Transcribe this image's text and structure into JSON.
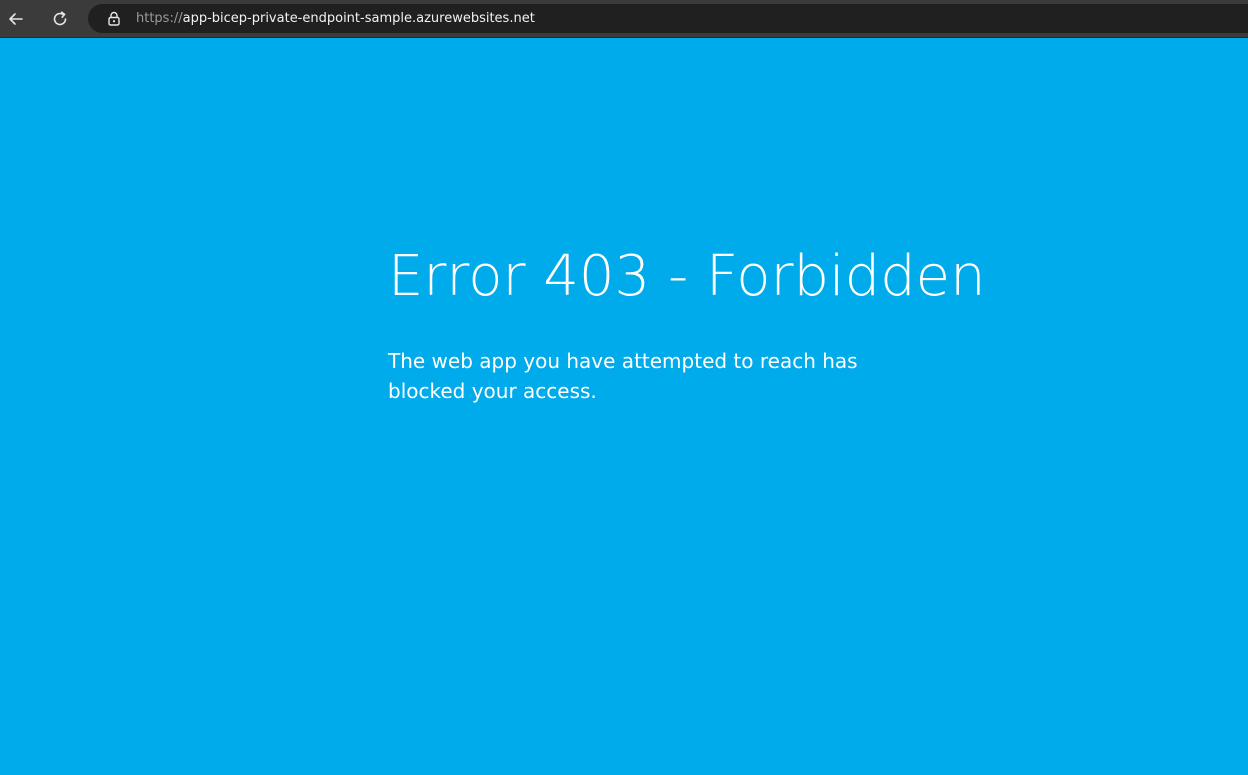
{
  "browser": {
    "back_icon": "arrow-left-icon",
    "reload_icon": "refresh-icon",
    "lock_icon": "lock-icon",
    "url_scheme": "https://",
    "url_host": "app-bicep-private-endpoint-sample.azurewebsites.net"
  },
  "page": {
    "background_color": "#00abec",
    "title": "Error 403 - Forbidden",
    "message": "The web app you have attempted to reach has blocked your access."
  }
}
